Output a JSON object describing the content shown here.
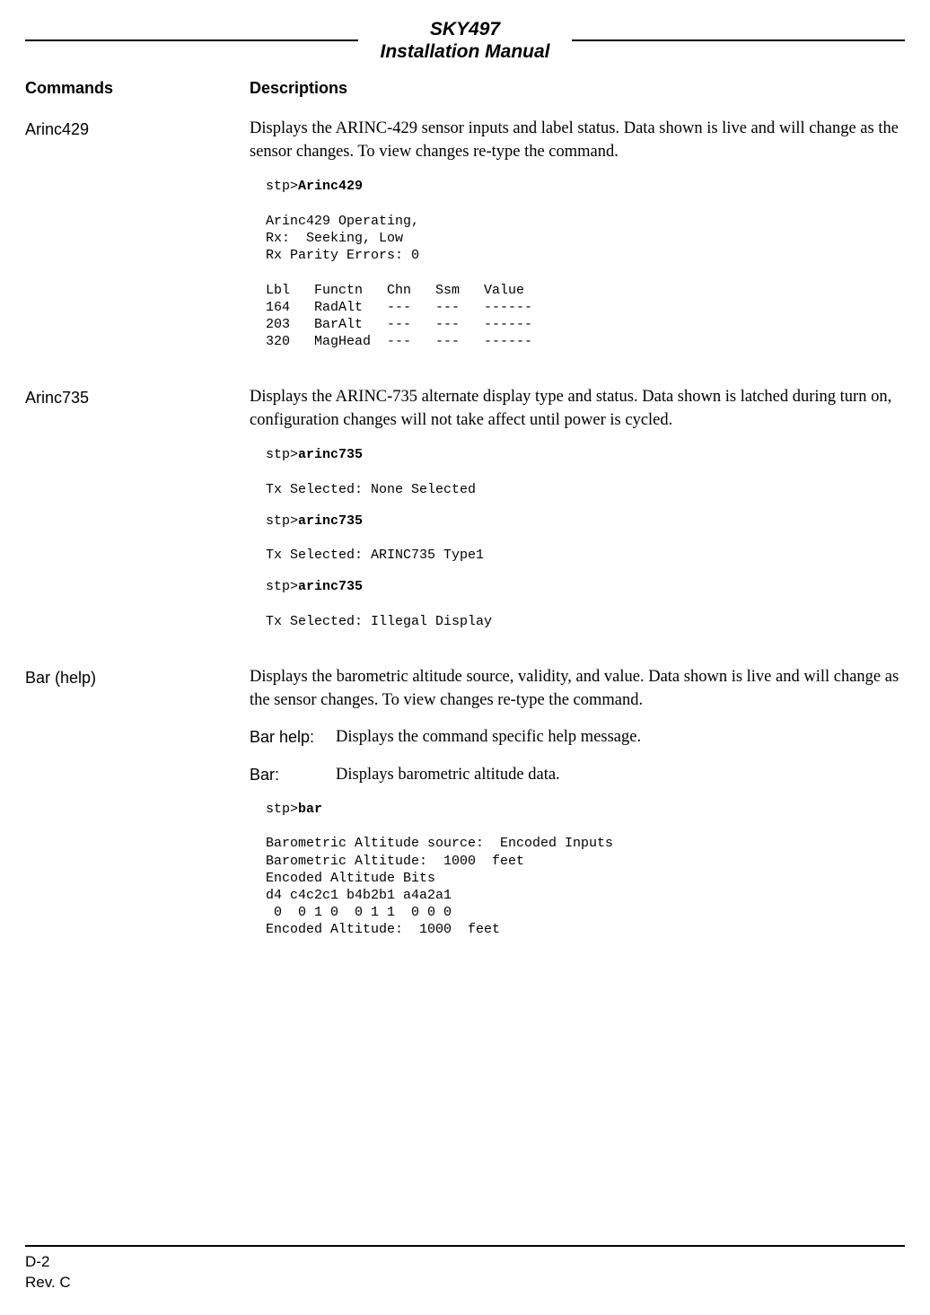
{
  "header": {
    "line1": "SKY497",
    "line2": "Installation Manual"
  },
  "columns": {
    "commands": "Commands",
    "descriptions": "Descriptions"
  },
  "entries": {
    "arinc429": {
      "cmd": "Arinc429",
      "desc": "Displays the ARINC-429 sensor inputs and label status. Data shown is live and will change as the sensor changes. To view changes re-type the command.",
      "console_prompt": "stp>",
      "console_cmd": "Arinc429",
      "console_body": "Arinc429 Operating,\nRx:  Seeking, Low\nRx Parity Errors: 0\n\nLbl   Functn   Chn   Ssm   Value\n164   RadAlt   ---   ---   ------\n203   BarAlt   ---   ---   ------\n320   MagHead  ---   ---   ------"
    },
    "arinc735": {
      "cmd": "Arinc735",
      "desc": "Displays the ARINC-735 alternate display type and status. Data shown is latched during turn on, configuration changes will not take affect until power is cycled.",
      "blocks": [
        {
          "prompt": "stp>",
          "cmd": "arinc735",
          "out": "Tx Selected: None Selected"
        },
        {
          "prompt": "stp>",
          "cmd": "arinc735",
          "out": "Tx Selected: ARINC735 Type1"
        },
        {
          "prompt": "stp>",
          "cmd": "arinc735",
          "out": "Tx Selected: Illegal Display"
        }
      ]
    },
    "bar": {
      "cmd": "Bar (help)",
      "desc": "Displays the barometric altitude source, validity, and value. Data shown is live and will change as the sensor changes. To view changes re-type the command.",
      "sub": {
        "help_label": "Bar help:",
        "help_text": "Displays the command specific help message.",
        "bar_label": "Bar:",
        "bar_text": "Displays barometric altitude data."
      },
      "console_prompt": "stp>",
      "console_cmd": "bar",
      "console_body": "Barometric Altitude source:  Encoded Inputs\nBarometric Altitude:  1000  feet\nEncoded Altitude Bits\nd4 c4c2c1 b4b2b1 a4a2a1\n 0  0 1 0  0 1 1  0 0 0\nEncoded Altitude:  1000  feet"
    }
  },
  "footer": {
    "page": "D-2",
    "rev": "Rev. C"
  }
}
